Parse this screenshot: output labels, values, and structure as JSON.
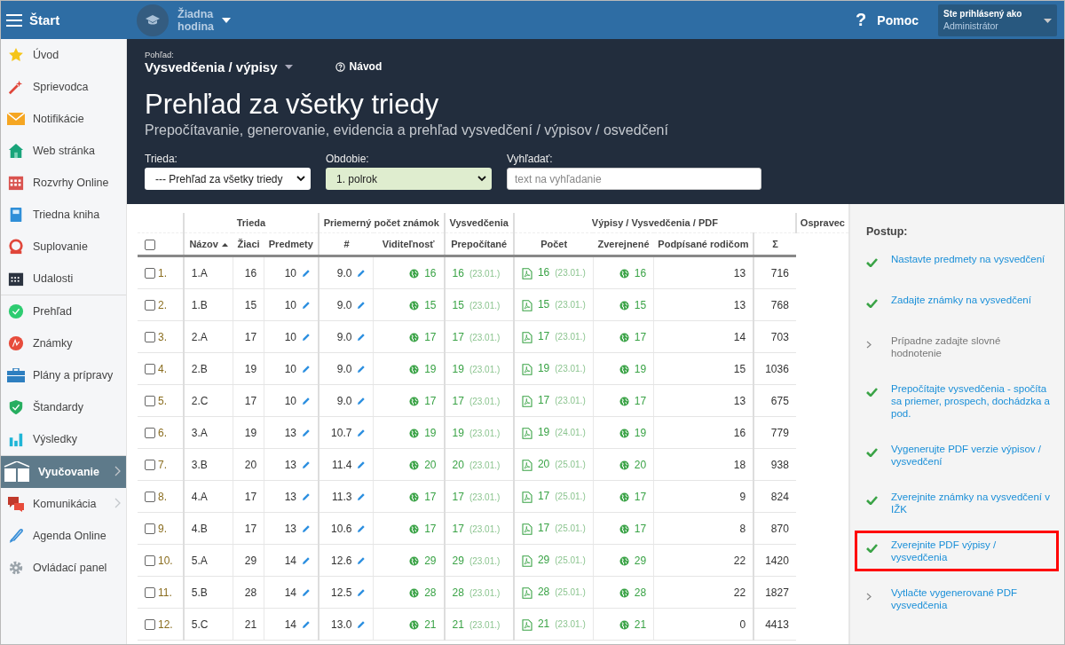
{
  "top_bar": {
    "menu_label": "Štart",
    "lesson": "Žiadna hodina",
    "help_glyph": "?",
    "help": "Pomoc",
    "user_caption": "Ste prihlásený ako",
    "user_name": "Administrátor"
  },
  "sidebar": {
    "groups": [
      [
        {
          "label": "Úvod",
          "selected": false,
          "submenu": false
        },
        {
          "label": "Sprievodca",
          "selected": false,
          "submenu": false
        },
        {
          "label": "Notifikácie",
          "selected": false,
          "submenu": false
        },
        {
          "label": "Web stránka",
          "selected": false,
          "submenu": false
        },
        {
          "label": "Rozvrhy Online",
          "selected": false,
          "submenu": false
        },
        {
          "label": "Triedna kniha",
          "selected": false,
          "submenu": false
        },
        {
          "label": "Suplovanie",
          "selected": false,
          "submenu": false
        },
        {
          "label": "Udalosti",
          "selected": false,
          "submenu": false
        }
      ],
      [
        {
          "label": "Prehľad",
          "selected": false,
          "submenu": false
        },
        {
          "label": "Známky",
          "selected": false,
          "submenu": false
        },
        {
          "label": "Plány a prípravy",
          "selected": false,
          "submenu": false
        },
        {
          "label": "Štandardy",
          "selected": false,
          "submenu": false
        },
        {
          "label": "Výsledky",
          "selected": false,
          "submenu": false
        }
      ],
      [
        {
          "label": "Vyučovanie",
          "selected": true,
          "submenu": true
        },
        {
          "label": "Komunikácia",
          "selected": false,
          "submenu": true
        },
        {
          "label": "Agenda Online",
          "selected": false,
          "submenu": false
        },
        {
          "label": "Ovládací panel",
          "selected": false,
          "submenu": false
        }
      ]
    ]
  },
  "header": {
    "view_caption": "Pohľad:",
    "view": "Vysvedčenia / výpisy",
    "guide": "Návod",
    "title": "Prehľad za všetky triedy",
    "subtitle": "Prepočítavanie, generovanie, evidencia a prehľad vysvedčení / výpisov / osvedčení",
    "filters": [
      {
        "kind": "select",
        "label": "Trieda:",
        "value": "--- Prehľad za všetky triedy",
        "highlighted": false
      },
      {
        "kind": "select",
        "label": "Obdobie:",
        "value": "1. polrok",
        "highlighted": true
      },
      {
        "kind": "text",
        "label": "Vyhľadať:",
        "placeholder": "text na vyhľadanie"
      }
    ]
  },
  "table": {
    "select_all_checked": false,
    "groups": [
      "Trieda",
      "Priemerný počet známok",
      "Vysvedčenia",
      "Výpisy / Vysvedčenia / PDF",
      "Ospravec"
    ],
    "columns": [
      {
        "label": "Názov",
        "sorted": true
      },
      {
        "label": "Žiaci",
        "sorted": false
      },
      {
        "label": "Predmety",
        "sorted": false
      },
      {
        "label": "#",
        "sorted": false
      },
      {
        "label": "Viditeľnosť",
        "sorted": false
      },
      {
        "label": "Prepočítané",
        "sorted": false
      },
      {
        "label": "Počet",
        "sorted": false
      },
      {
        "label": "Zverejnené",
        "sorted": false
      },
      {
        "label": "Podpísané rodičom",
        "sorted": false
      },
      {
        "label": "Σ",
        "sorted": false
      }
    ],
    "rows": [
      {
        "checked": false,
        "index": "1.",
        "name": "1.A",
        "students": "16",
        "subjects": "10",
        "average": "9.0",
        "visible": "16",
        "recalculated": "16",
        "recalculated_date": "(23.01.)",
        "pdf_count": "16",
        "pdf_date": "(23.01.)",
        "published": "16",
        "signed": "13",
        "sum": "716"
      },
      {
        "checked": false,
        "index": "2.",
        "name": "1.B",
        "students": "15",
        "subjects": "10",
        "average": "9.0",
        "visible": "15",
        "recalculated": "15",
        "recalculated_date": "(23.01.)",
        "pdf_count": "15",
        "pdf_date": "(23.01.)",
        "published": "15",
        "signed": "13",
        "sum": "768"
      },
      {
        "checked": false,
        "index": "3.",
        "name": "2.A",
        "students": "17",
        "subjects": "10",
        "average": "9.0",
        "visible": "17",
        "recalculated": "17",
        "recalculated_date": "(23.01.)",
        "pdf_count": "17",
        "pdf_date": "(23.01.)",
        "published": "17",
        "signed": "14",
        "sum": "703"
      },
      {
        "checked": false,
        "index": "4.",
        "name": "2.B",
        "students": "19",
        "subjects": "10",
        "average": "9.0",
        "visible": "19",
        "recalculated": "19",
        "recalculated_date": "(23.01.)",
        "pdf_count": "19",
        "pdf_date": "(23.01.)",
        "published": "19",
        "signed": "15",
        "sum": "1036"
      },
      {
        "checked": false,
        "index": "5.",
        "name": "2.C",
        "students": "17",
        "subjects": "10",
        "average": "9.0",
        "visible": "17",
        "recalculated": "17",
        "recalculated_date": "(23.01.)",
        "pdf_count": "17",
        "pdf_date": "(23.01.)",
        "published": "17",
        "signed": "13",
        "sum": "675"
      },
      {
        "checked": false,
        "index": "6.",
        "name": "3.A",
        "students": "19",
        "subjects": "13",
        "average": "10.7",
        "visible": "19",
        "recalculated": "19",
        "recalculated_date": "(23.01.)",
        "pdf_count": "19",
        "pdf_date": "(24.01.)",
        "published": "19",
        "signed": "16",
        "sum": "779"
      },
      {
        "checked": false,
        "index": "7.",
        "name": "3.B",
        "students": "20",
        "subjects": "13",
        "average": "11.4",
        "visible": "20",
        "recalculated": "20",
        "recalculated_date": "(23.01.)",
        "pdf_count": "20",
        "pdf_date": "(25.01.)",
        "published": "20",
        "signed": "18",
        "sum": "938"
      },
      {
        "checked": false,
        "index": "8.",
        "name": "4.A",
        "students": "17",
        "subjects": "13",
        "average": "11.3",
        "visible": "17",
        "recalculated": "17",
        "recalculated_date": "(23.01.)",
        "pdf_count": "17",
        "pdf_date": "(25.01.)",
        "published": "17",
        "signed": "9",
        "sum": "824"
      },
      {
        "checked": false,
        "index": "9.",
        "name": "4.B",
        "students": "17",
        "subjects": "13",
        "average": "10.6",
        "visible": "17",
        "recalculated": "17",
        "recalculated_date": "(23.01.)",
        "pdf_count": "17",
        "pdf_date": "(25.01.)",
        "published": "17",
        "signed": "8",
        "sum": "870"
      },
      {
        "checked": false,
        "index": "10.",
        "name": "5.A",
        "students": "29",
        "subjects": "14",
        "average": "12.6",
        "visible": "29",
        "recalculated": "29",
        "recalculated_date": "(23.01.)",
        "pdf_count": "29",
        "pdf_date": "(25.01.)",
        "published": "29",
        "signed": "22",
        "sum": "1420"
      },
      {
        "checked": false,
        "index": "11.",
        "name": "5.B",
        "students": "28",
        "subjects": "14",
        "average": "12.5",
        "visible": "28",
        "recalculated": "28",
        "recalculated_date": "(23.01.)",
        "pdf_count": "28",
        "pdf_date": "(25.01.)",
        "published": "28",
        "signed": "22",
        "sum": "1827"
      },
      {
        "checked": false,
        "index": "12.",
        "name": "5.C",
        "students": "21",
        "subjects": "14",
        "average": "13.0",
        "visible": "21",
        "recalculated": "21",
        "recalculated_date": "(23.01.)",
        "pdf_count": "21",
        "pdf_date": "(23.01.)",
        "published": "21",
        "signed": "0",
        "sum": "4413"
      }
    ]
  },
  "steps": {
    "title": "Postup:",
    "items": [
      {
        "label": "Nastavte predmety na vysvedčení",
        "done": true,
        "muted": false,
        "highlighted": false
      },
      {
        "label": "Zadajte známky na vysvedčení",
        "done": true,
        "muted": false,
        "highlighted": false
      },
      {
        "label": "Prípadne zadajte slovné hodnotenie",
        "done": false,
        "muted": true,
        "highlighted": false
      },
      {
        "label": "Prepočítajte vysvedčenia - spočíta sa priemer, prospech, dochádzka a pod.",
        "done": true,
        "muted": false,
        "highlighted": false
      },
      {
        "label": "Vygenerujte PDF verzie výpisov / vysvedčení",
        "done": true,
        "muted": false,
        "highlighted": false
      },
      {
        "label": "Zverejnite známky na vysvedčení v IŽK",
        "done": true,
        "muted": false,
        "highlighted": false
      },
      {
        "label": "Zverejnite PDF výpisy / vysvedčenia",
        "done": true,
        "muted": false,
        "highlighted": true
      },
      {
        "label": "Vytlačte vygenerované PDF vysvedčenia",
        "done": false,
        "muted": false,
        "highlighted": false
      }
    ]
  }
}
